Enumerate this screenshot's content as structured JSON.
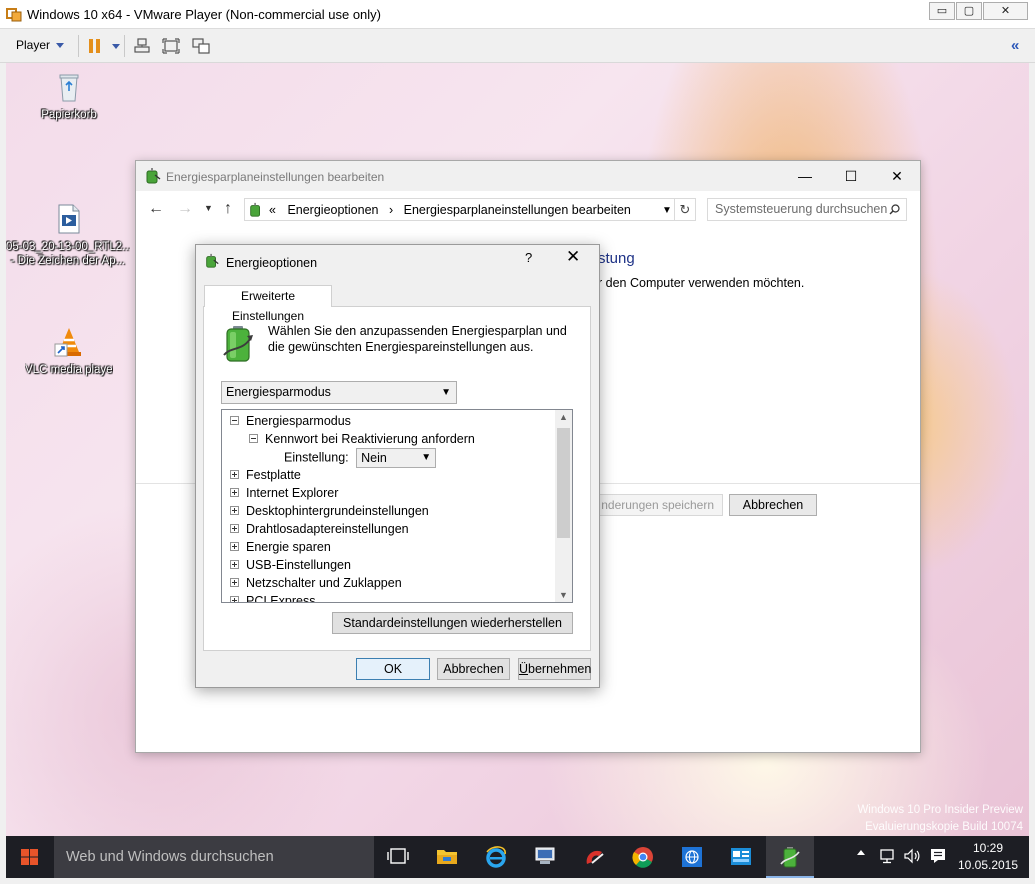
{
  "vmware": {
    "title": "Windows 10 x64 - VMware Player (Non-commercial use only)",
    "player_menu": "Player",
    "window_controls": {
      "minimize": "▭",
      "maximize": "▢",
      "close": "✕"
    }
  },
  "desktop": {
    "icons": [
      {
        "label": "Papierkorb",
        "icon": "recycle-bin-icon"
      },
      {
        "label_line1": "05-03_20-13-00_RTL2...",
        "label_line2": "- Die Zeichen der Ap...",
        "icon": "media-file-icon"
      },
      {
        "label": "VLC media player",
        "icon": "vlc-icon"
      }
    ],
    "watermark": {
      "line1": "Windows 10 Pro Insider Preview",
      "line2": "Evaluierungskopie Build 10074"
    }
  },
  "control_panel": {
    "title": "Energiesparplaneinstellungen bearbeiten",
    "address": {
      "prefix": "«",
      "crumb1": "Energieoptionen",
      "separator": "›",
      "crumb2": "Energiesparplaneinstellungen bearbeiten"
    },
    "search_placeholder": "Systemsteuerung durchsuchen",
    "heading_fragment": "stung",
    "subtext_fragment": "r den Computer verwenden möchten.",
    "save_fragment": "nderungen speichern",
    "cancel_label": "Abbrechen"
  },
  "dialog": {
    "title": "Energieoptionen",
    "help": "?",
    "close": "✕",
    "tab_label": "Erweiterte Einstellungen",
    "description": "Wählen Sie den anzupassenden Energiesparplan und die gewünschten Energiespareinstellungen aus.",
    "plan_selected": "Energiesparmodus",
    "tree": {
      "root": "Energiesparmodus",
      "child": "Kennwort bei Reaktivierung anfordern",
      "setting_label": "Einstellung:",
      "setting_value": "Nein",
      "items": [
        "Festplatte",
        "Internet Explorer",
        "Desktophintergrundeinstellungen",
        "Drahtlosadaptereinstellungen",
        "Energie sparen",
        "USB-Einstellungen",
        "Netzschalter und Zuklappen",
        "PCI Express"
      ]
    },
    "restore_label": "Standardeinstellungen wiederherstellen",
    "ok_label": "OK",
    "cancel_label": "Abbrechen",
    "apply_prefix": "Ü",
    "apply_rest": "bernehmen"
  },
  "taskbar": {
    "search_placeholder": "Web und Windows durchsuchen",
    "time": "10:29",
    "date": "10.05.2015",
    "accent": "#0078d7"
  }
}
